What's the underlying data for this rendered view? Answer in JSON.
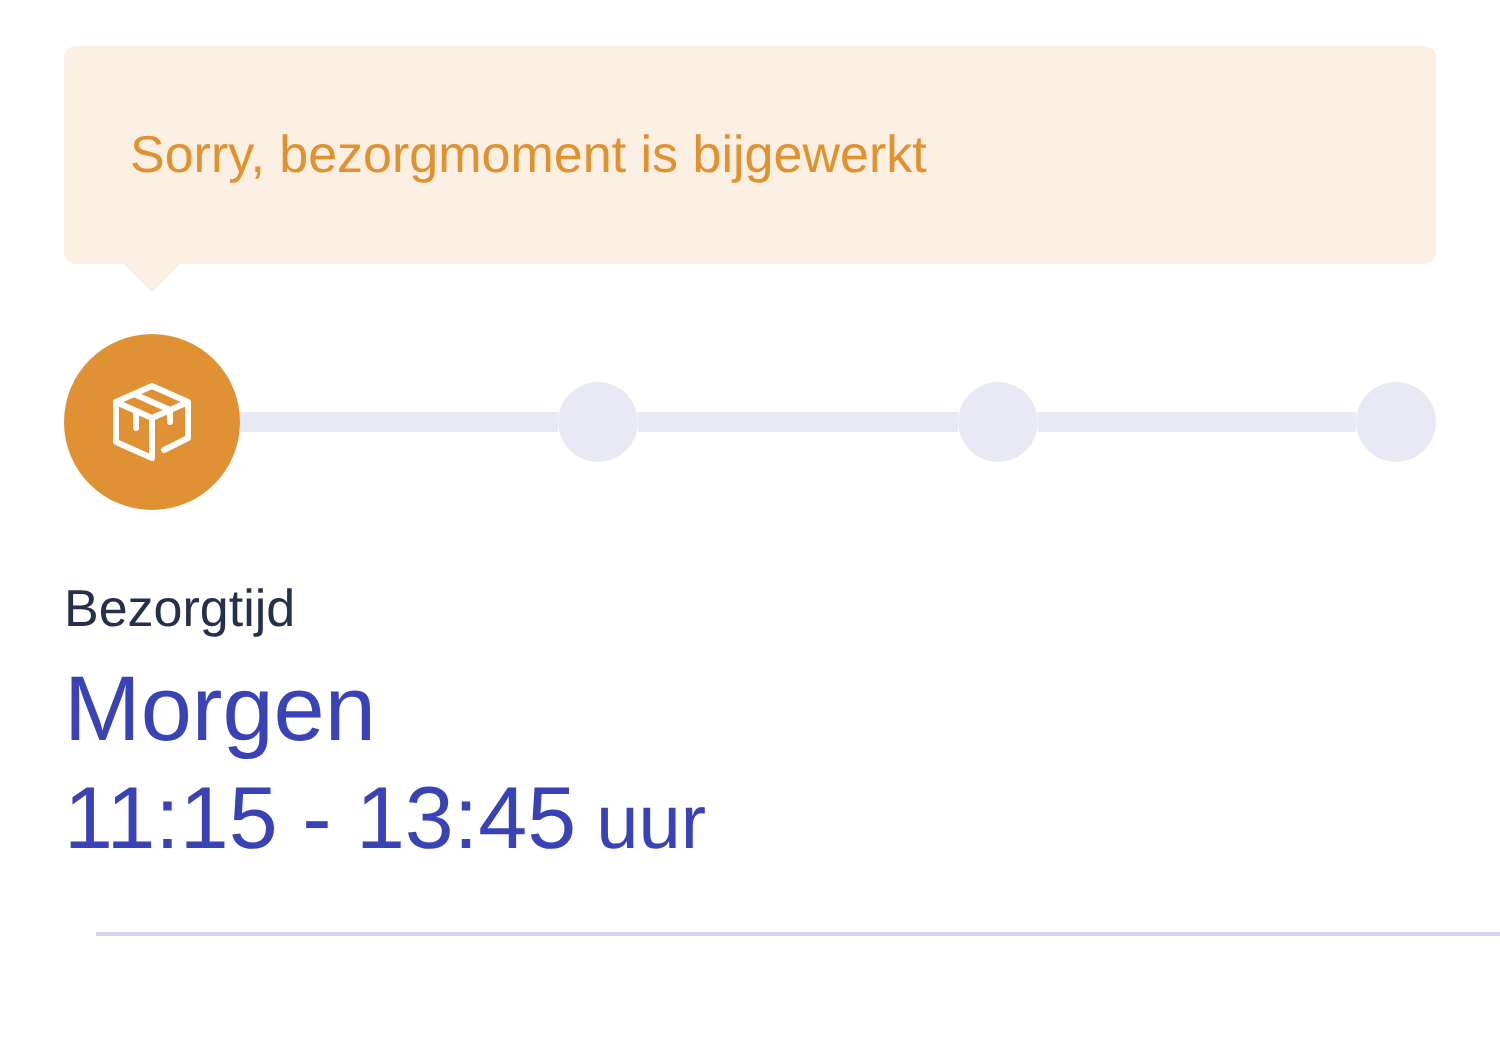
{
  "notice": {
    "message": "Sorry, bezorgmoment is bijgewerkt"
  },
  "steps": [
    {
      "active": true
    },
    {
      "active": false
    },
    {
      "active": false
    },
    {
      "active": false
    }
  ],
  "delivery": {
    "label": "Bezorgtijd",
    "day": "Morgen",
    "time": "11:15 - 13:45",
    "unit": "uur"
  }
}
